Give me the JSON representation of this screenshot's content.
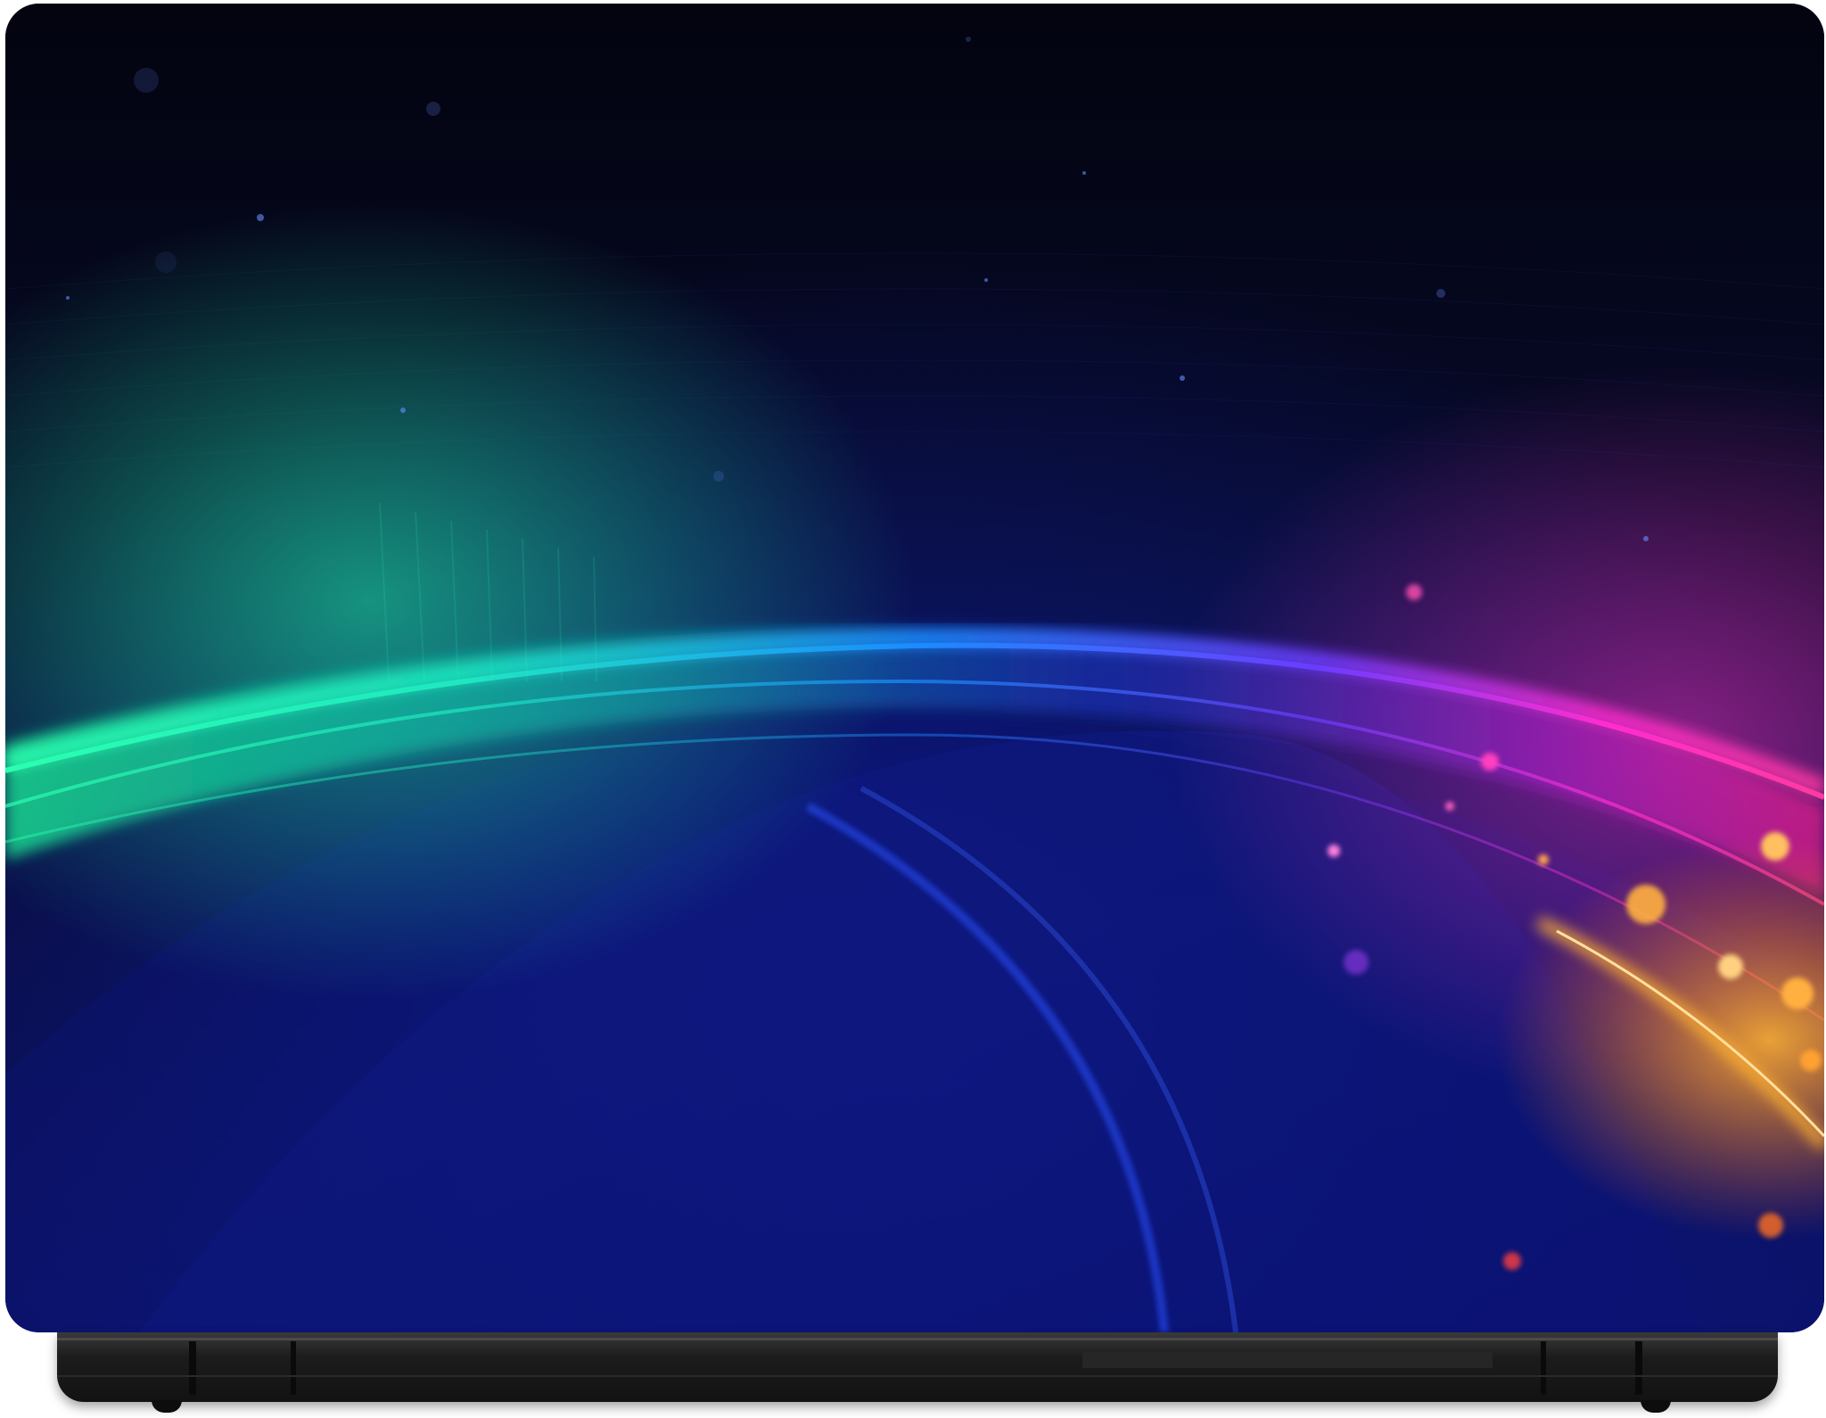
{
  "scene": {
    "subject": "laptop-skin-wallpaper",
    "colors": {
      "background_top": "#04061a",
      "background_bottom": "#0a0d4a",
      "arc_green": "#1ee8a0",
      "arc_cyan": "#18c8e0",
      "arc_blue": "#2a4cff",
      "arc_purple": "#8a2cff",
      "arc_magenta": "#ff2cc8",
      "sparkle_orange": "#ffb030",
      "base_body": "#1a1a1a"
    }
  }
}
